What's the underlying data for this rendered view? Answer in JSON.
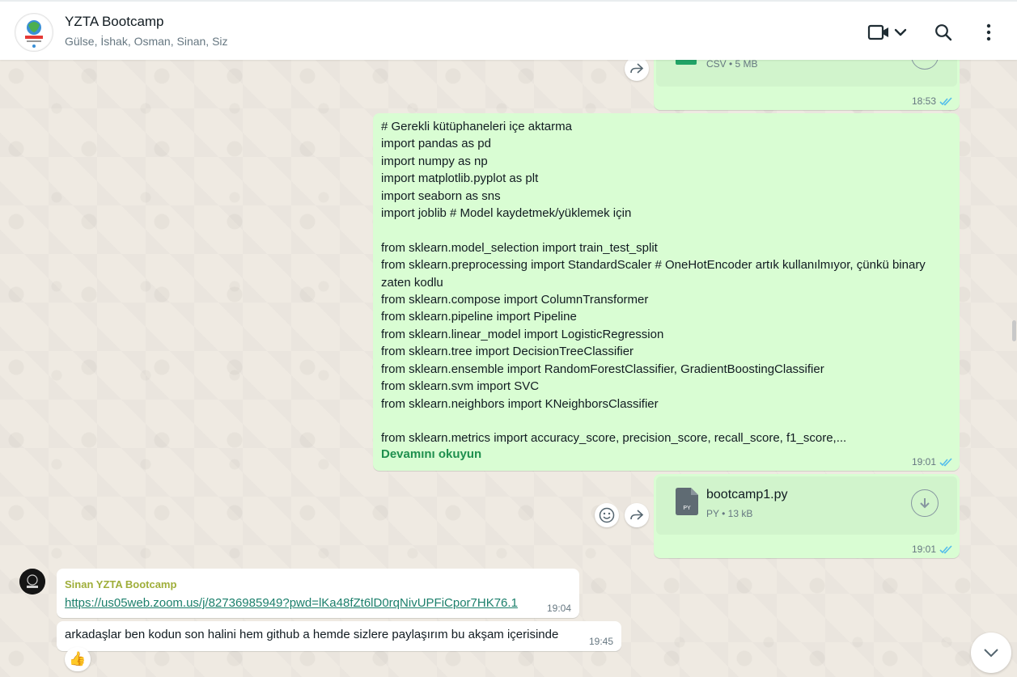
{
  "header": {
    "group_name": "YZTA Bootcamp",
    "members": "Gülse, İshak, Osman, Sinan, Siz",
    "avatar_text": "BOOTCAMP"
  },
  "messages": {
    "csv_file": {
      "meta": "CSV • 5 MB",
      "time": "18:53"
    },
    "code": {
      "text": "# Gerekli kütüphaneleri içe aktarma\nimport pandas as pd\nimport numpy as np\nimport matplotlib.pyplot as plt\nimport seaborn as sns\nimport joblib # Model kaydetmek/yüklemek için\n\nfrom sklearn.model_selection import train_test_split\nfrom sklearn.preprocessing import StandardScaler # OneHotEncoder artık kullanılmıyor, çünkü binary zaten kodlu\nfrom sklearn.compose import ColumnTransformer\nfrom sklearn.pipeline import Pipeline\nfrom sklearn.linear_model import LogisticRegression\nfrom sklearn.tree import DecisionTreeClassifier\nfrom sklearn.ensemble import RandomForestClassifier, GradientBoostingClassifier\nfrom sklearn.svm import SVC\nfrom sklearn.neighbors import KNeighborsClassifier\n\nfrom sklearn.metrics import accuracy_score, precision_score, recall_score, f1_score,...",
      "read_more": "Devamını okuyun",
      "time": "19:01"
    },
    "py_file": {
      "name": "bootcamp1.py",
      "meta": "PY • 13 kB",
      "icon_label": "PY",
      "time": "19:01"
    },
    "incoming_link": {
      "sender": "Sinan YZTA Bootcamp",
      "url": "https://us05web.zoom.us/j/82736985949?pwd=lKa48fZt6lD0rqNivUPFiCpor7HK76.1",
      "time": "19:04"
    },
    "incoming_text": {
      "text": "arkadaşlar ben kodun son halini hem github a hemde sizlere paylaşırım bu akşam içerisinde",
      "time": "19:45",
      "reaction": "👍"
    }
  },
  "colors": {
    "outgoing_bubble": "#d9fdd3",
    "incoming_bubble": "#ffffff",
    "read_ticks": "#53bdeb",
    "wallpaper": "#efeae2"
  }
}
